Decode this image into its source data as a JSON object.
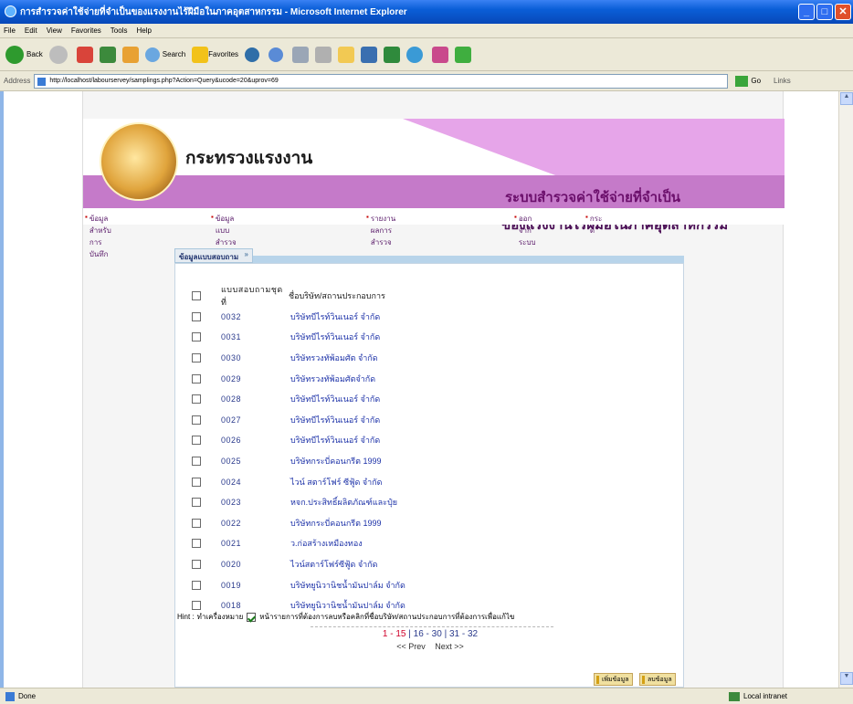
{
  "window": {
    "title": "การสำรวจค่าใช้จ่ายที่จำเป็นของแรงงานไร้ฝีมือในภาคอุตสาหกรรม - Microsoft Internet Explorer",
    "minimize": "_",
    "maximize": "□",
    "close": "✕"
  },
  "menu": [
    "File",
    "Edit",
    "View",
    "Favorites",
    "Tools",
    "Help"
  ],
  "toolbar": {
    "back": "Back",
    "search": "Search",
    "favorites": "Favorites"
  },
  "address": {
    "label": "Address",
    "url": "http://localhost/labourservey/samplings.php?Action=Query&ucode=20&uprov=69",
    "go": "Go",
    "links": "Links"
  },
  "header": {
    "ministry": "กระทรวงแรงงาน",
    "system_line1": "ระบบสำรวจค่าใช้จ่ายที่จำเป็น",
    "system_line2": "ของแรงงานไร้ฝีมือในภาคอุตสาหกรรม"
  },
  "nav": [
    "ข้อมูลสำหรับการบันทึก",
    "ข้อมูลแบบสำรวจ",
    "รายงานผลการสำรวจ",
    "ออกจากระบบ",
    "กระดี้"
  ],
  "panel": {
    "tab": "ข้อมูลแบบสอบถาม",
    "chevron": "»"
  },
  "columns": {
    "number": "แบบสอบถามชุดที่",
    "name": "ชื่อบริษัท/สถานประกอบการ"
  },
  "rows": [
    {
      "code": "0032",
      "name": "บริษัทบีไรท์วินเนอร์ จำกัด"
    },
    {
      "code": "0031",
      "name": "บริษัทบีไรท์วินเนอร์ จำกัด"
    },
    {
      "code": "0030",
      "name": "บริษัทรวงทัพ้อมศัต จำกัด"
    },
    {
      "code": "0029",
      "name": "บริษัทรวงทัพ้อมศัตจำกัด"
    },
    {
      "code": "0028",
      "name": "บริษัทบีไรท์วินเนอร์ จำกัด"
    },
    {
      "code": "0027",
      "name": "บริษัทบีไรท์วินเนอร์ จำกัด"
    },
    {
      "code": "0026",
      "name": "บริษัทบีไรท์วินเนอร์ จำกัด"
    },
    {
      "code": "0025",
      "name": "บริษัทกระบี่คอนกรีต 1999"
    },
    {
      "code": "0024",
      "name": "ไวน์ สตาร์โฟร์ ซีฟู้ด จำกัด"
    },
    {
      "code": "0023",
      "name": "หจก.ประสิทธิ์ผลิตภัณฑ์และปุ๋ย"
    },
    {
      "code": "0022",
      "name": "บริษัทกระบี่คอนกรีต 1999"
    },
    {
      "code": "0021",
      "name": "ว.ก่อสร้างเหมืองทอง"
    },
    {
      "code": "0020",
      "name": "ไวน์สตาร์โฟร์ซีฟู้ด จำกัด"
    },
    {
      "code": "0019",
      "name": "บริษัทยูนิวานิชน้ำมันปาล์ม จำกัด"
    },
    {
      "code": "0018",
      "name": "บริษัทยูนิวานิชน้ำมันปาล์ม จำกัด"
    }
  ],
  "hint": {
    "label": "Hint :",
    "prefix": "ทำเครื่องหมาย",
    "text": "หน้ารายการที่ต้องการลบหรือคลิกที่ชื่อบริษัท/สถานประกอบการที่ต้องการเพื่อแก้ไข"
  },
  "pager": {
    "current": "1 - 15",
    "pages": "| 16 - 30 | 31 - 32",
    "prev": "<< Prev",
    "next": "Next >>"
  },
  "buttons": {
    "add": "เพิ่มข้อมูล",
    "delete": "ลบข้อมูล"
  },
  "status": {
    "left": "Done",
    "right": "Local intranet"
  }
}
